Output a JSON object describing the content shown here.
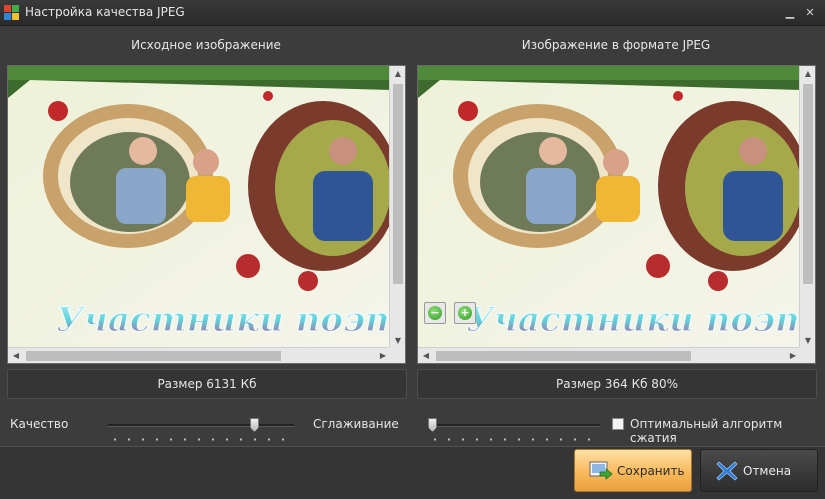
{
  "window": {
    "title": "Настройка качества JPEG",
    "minimize_glyph": "▁",
    "close_glyph": "✕"
  },
  "panels": {
    "left_caption": "Исходное изображение",
    "right_caption": "Изображение в формате JPEG",
    "overlay_text": "Участники поэтического",
    "left_size": "Размер 6131 Кб",
    "right_size": "Размер 364 Кб 80%"
  },
  "zoom": {
    "out_glyph": "−",
    "in_glyph": "+"
  },
  "controls": {
    "quality_label": "Качество",
    "quality_value_percent": 80,
    "smoothing_label": "Сглаживание",
    "smoothing_value_percent": 0,
    "optimal_label": "Оптимальный алгоритм сжатия",
    "optimal_checked": false
  },
  "buttons": {
    "save_label": "Сохранить",
    "cancel_label": "Отмена"
  },
  "colors": {
    "accent_save": "#f8b95b",
    "background": "#3c3c3c",
    "cancel_icon": "#2e7bd6"
  },
  "icons": {
    "app": "app-icon",
    "save": "save-icon",
    "cancel": "cancel-icon",
    "zoom_out": "zoom-out-icon",
    "zoom_in": "zoom-in-icon"
  }
}
